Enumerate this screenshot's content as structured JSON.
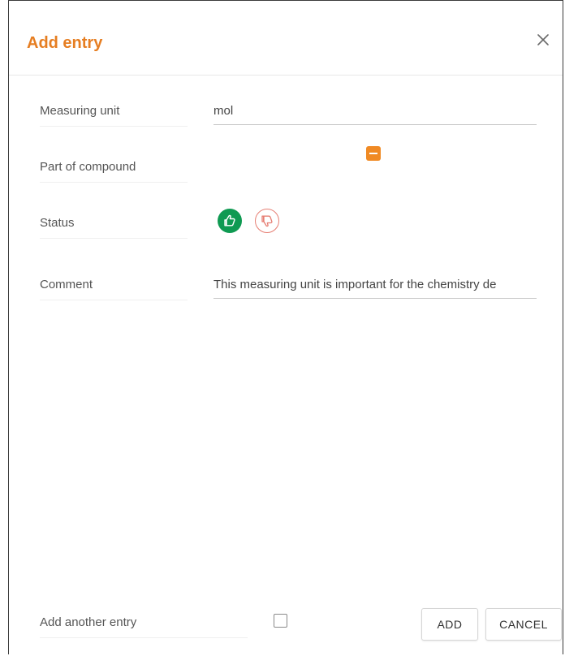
{
  "dialog": {
    "title": "Add entry",
    "accent_color": "#e67e22"
  },
  "form": {
    "measuring_unit": {
      "label": "Measuring unit",
      "value": "mol"
    },
    "part_of_compound": {
      "label": "Part of compound",
      "state": "indeterminate",
      "color": "#f08a24"
    },
    "status": {
      "label": "Status",
      "approve_icon": "thumbs-up-icon",
      "approve_color": "#0f9a52",
      "reject_icon": "thumbs-down-icon",
      "reject_color": "#e67e73"
    },
    "comment": {
      "label": "Comment",
      "value": "This measuring unit is important for the chemistry de"
    }
  },
  "footer": {
    "add_another_label": "Add another entry",
    "add_another_checked": false,
    "add_button": "ADD",
    "cancel_button": "CANCEL"
  }
}
